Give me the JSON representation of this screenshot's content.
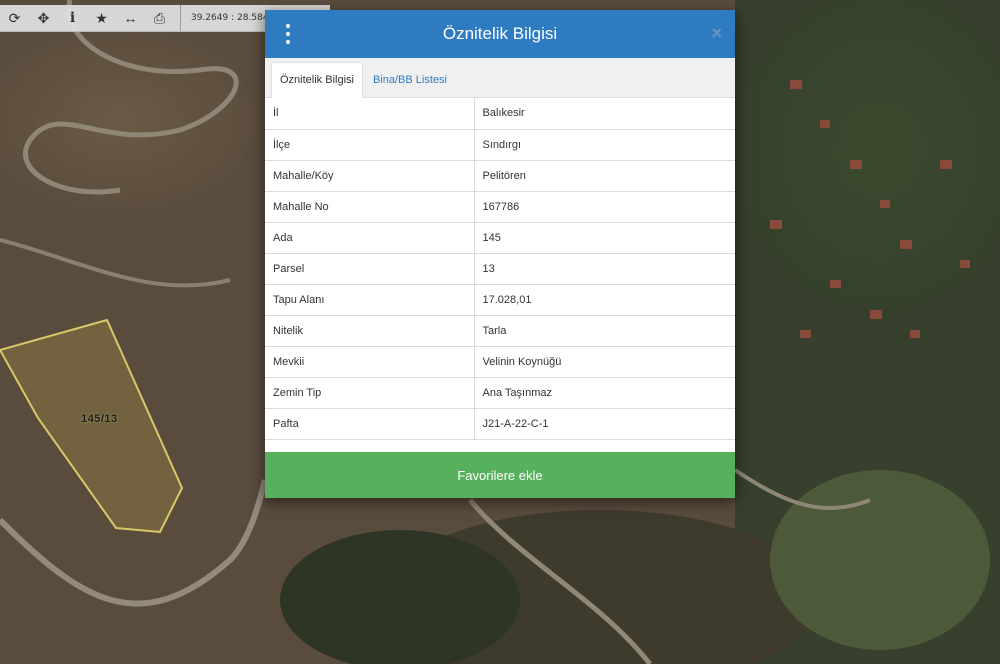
{
  "toolbar": {
    "buttons": [
      {
        "icon": "refresh-icon",
        "glyph": "⟳"
      },
      {
        "icon": "crosshair-icon",
        "glyph": "✥"
      },
      {
        "icon": "info-icon",
        "glyph": "i"
      },
      {
        "icon": "star-icon",
        "glyph": "★"
      },
      {
        "icon": "measure-icon",
        "glyph": "↔"
      },
      {
        "icon": "print-icon",
        "glyph": "⎙"
      }
    ],
    "coordinates": "39.2649 : 28.584"
  },
  "map": {
    "parcel_label": "145/13",
    "parcel_outline_color": "#d8c86a"
  },
  "modal": {
    "title": "Öznitelik Bilgisi",
    "close_glyph": "×",
    "header_color": "#2f7bc2",
    "tabs": [
      {
        "label": "Öznitelik Bilgisi",
        "active": true
      },
      {
        "label": "Bina/BB Listesi",
        "active": false
      }
    ],
    "rows": [
      {
        "key": "İl",
        "value": "Balıkesir"
      },
      {
        "key": "İlçe",
        "value": "Sındırgı"
      },
      {
        "key": "Mahalle/Köy",
        "value": "Pelitören"
      },
      {
        "key": "Mahalle No",
        "value": "167786"
      },
      {
        "key": "Ada",
        "value": "145"
      },
      {
        "key": "Parsel",
        "value": "13"
      },
      {
        "key": "Tapu Alanı",
        "value": "17.028,01"
      },
      {
        "key": "Nitelik",
        "value": "Tarla"
      },
      {
        "key": "Mevkii",
        "value": "Velinin Koynüğü"
      },
      {
        "key": "Zemin Tip",
        "value": "Ana Taşınmaz"
      },
      {
        "key": "Pafta",
        "value": "J21-A-22-C-1"
      }
    ],
    "favorite_button": "Favorilere ekle",
    "favorite_color": "#57b05c"
  }
}
